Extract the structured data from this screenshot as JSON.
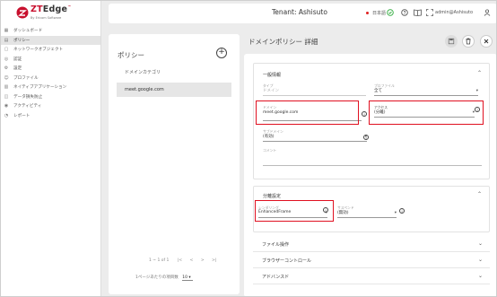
{
  "brand": {
    "name_zt": "ZT",
    "name_edge": "Edge",
    "tm": "™",
    "sub": "By Ericom Software"
  },
  "sidebar": {
    "items": [
      {
        "icon": "dashboard-icon",
        "glyph": "▦",
        "label": "ダッシュボード",
        "active": false
      },
      {
        "icon": "policy-icon",
        "glyph": "▤",
        "label": "ポリシー",
        "active": true
      },
      {
        "icon": "network-object-icon",
        "glyph": "▢",
        "label": "ネットワークオブジェクト",
        "active": false
      },
      {
        "icon": "auth-icon",
        "glyph": "◎",
        "label": "認証",
        "active": false
      },
      {
        "icon": "location-icon",
        "glyph": "⚙",
        "label": "設定",
        "active": false
      },
      {
        "icon": "profile-icon",
        "glyph": "☺",
        "label": "プロファイル",
        "active": false
      },
      {
        "icon": "native-app-icon",
        "glyph": "▥",
        "label": "ネイティブアプリケーション",
        "active": false
      },
      {
        "icon": "data-loss-icon",
        "glyph": "◫",
        "label": "データ損失防止",
        "active": false
      },
      {
        "icon": "audit-icon",
        "glyph": "◉",
        "label": "アクティビティ",
        "active": false
      },
      {
        "icon": "report-icon",
        "glyph": "◔",
        "label": "レポート",
        "active": false
      }
    ]
  },
  "header": {
    "tenant": "Tenant: Ashisuto",
    "lang": "日本語",
    "user": "admin@Ashisuto"
  },
  "policy_list": {
    "title": "ポリシー",
    "category": "ドメインカテゴリ",
    "items": [
      "meet.google.com"
    ],
    "pager": "1 ~ 1 of 1",
    "per_page_label": "1ページあたりの項目数",
    "per_page_value": "10"
  },
  "detail": {
    "title": "ドメインポリシー 詳細",
    "general": {
      "heading": "一般情報",
      "type_label": "タイプ",
      "type_value": "ドメイン",
      "profile_label": "プロファイル",
      "profile_value": "全て",
      "domain_label": "ドメイン",
      "domain_value": "meet.google.com",
      "access_label": "アクセス",
      "access_value": "(分離)",
      "subdomain_label": "サブドメイン",
      "subdomain_value": "(有効)",
      "comment_label": "コメント",
      "comment_value": ""
    },
    "isolation": {
      "heading": "分離設定",
      "rendering_label": "レンダリング",
      "rendering_value": "EnhancedFrame",
      "suspend_label": "サスペンド",
      "suspend_value": "(無効)"
    },
    "sections": [
      "ファイル操作",
      "ブラウザーコントロール",
      "アドバンスド"
    ]
  },
  "colors": {
    "highlight": "#e01020",
    "logo_red": "#c8102e",
    "status_green": "#2eaa3c"
  }
}
